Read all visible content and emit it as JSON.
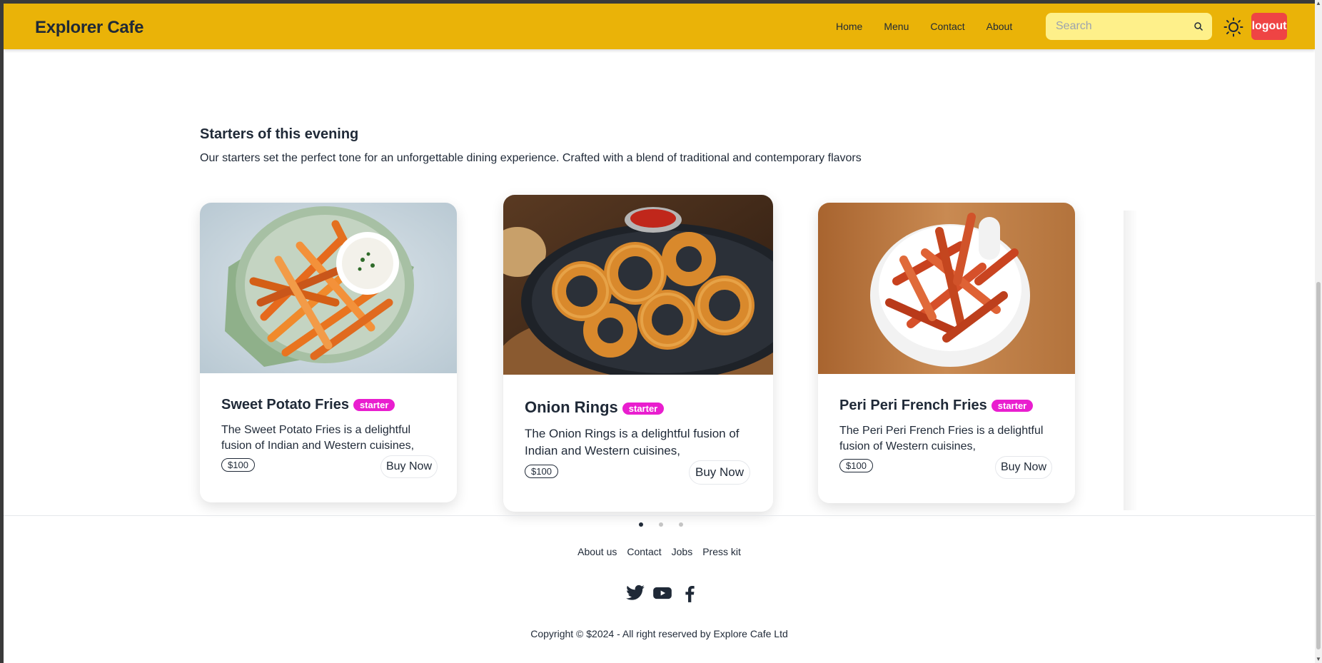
{
  "brand": "Explorer Cafe",
  "nav": {
    "items": [
      "Home",
      "Menu",
      "Contact",
      "About"
    ]
  },
  "search": {
    "placeholder": "Search"
  },
  "logout_label": "logout",
  "section": {
    "title": "Starters of this evening",
    "description": "Our starters set the perfect tone for an unforgettable dining experience. Crafted with a blend of traditional and contemporary flavors"
  },
  "cards": [
    {
      "title": "Sweet Potato Fries",
      "badge": "starter",
      "desc_line1": "The Sweet Potato Fries is a delightful",
      "desc_line2": "fusion of Indian and Western cuisines,",
      "price": "$100",
      "button": "Buy Now"
    },
    {
      "title": "Onion Rings",
      "badge": "starter",
      "desc_line1": "The Onion Rings is a delightful fusion of",
      "desc_line2": "Indian and Western cuisines,",
      "price": "$100",
      "button": "Buy Now"
    },
    {
      "title": "Peri Peri French Fries",
      "badge": "starter",
      "desc_line1": "The Peri Peri French Fries is a delightful",
      "desc_line2": "fusion of Western cuisines,",
      "price": "$100",
      "button": "Buy Now"
    }
  ],
  "carousel": {
    "active_index": 0,
    "total": 3
  },
  "footer": {
    "links": [
      "About us",
      "Contact",
      "Jobs",
      "Press kit"
    ],
    "social": [
      "twitter-icon",
      "youtube-icon",
      "facebook-icon"
    ],
    "copyright": "Copyright © $2024 - All right reserved by Explore Cafe Ltd"
  },
  "colors": {
    "navbar": "#eab308",
    "search_bg": "#fef08a",
    "logout": "#ef4444",
    "badge": "#e91ecf"
  }
}
